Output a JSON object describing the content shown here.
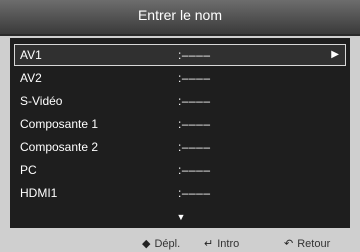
{
  "header": {
    "title": "Entrer le nom"
  },
  "list": {
    "items": [
      {
        "label": "AV1",
        "value": ":––––",
        "arrow": "▶"
      },
      {
        "label": "AV2",
        "value": ":––––"
      },
      {
        "label": "S-Vidéo",
        "value": ":––––"
      },
      {
        "label": "Composante 1",
        "value": ":––––"
      },
      {
        "label": "Composante 2",
        "value": ":––––"
      },
      {
        "label": "PC",
        "value": ":––––"
      },
      {
        "label": "HDMI1",
        "value": ":––––"
      }
    ],
    "scroll_indicator": "▼"
  },
  "footer": {
    "move_icon": "◆",
    "move_label": "Dépl.",
    "enter_icon": "↵",
    "enter_label": "Intro",
    "return_icon": "↶",
    "return_label": "Retour"
  },
  "colors": {
    "background": "#cfcfcf",
    "panel": "#1e1e1e",
    "selected_border": "#d8d8d8",
    "text": "#ffffff"
  }
}
